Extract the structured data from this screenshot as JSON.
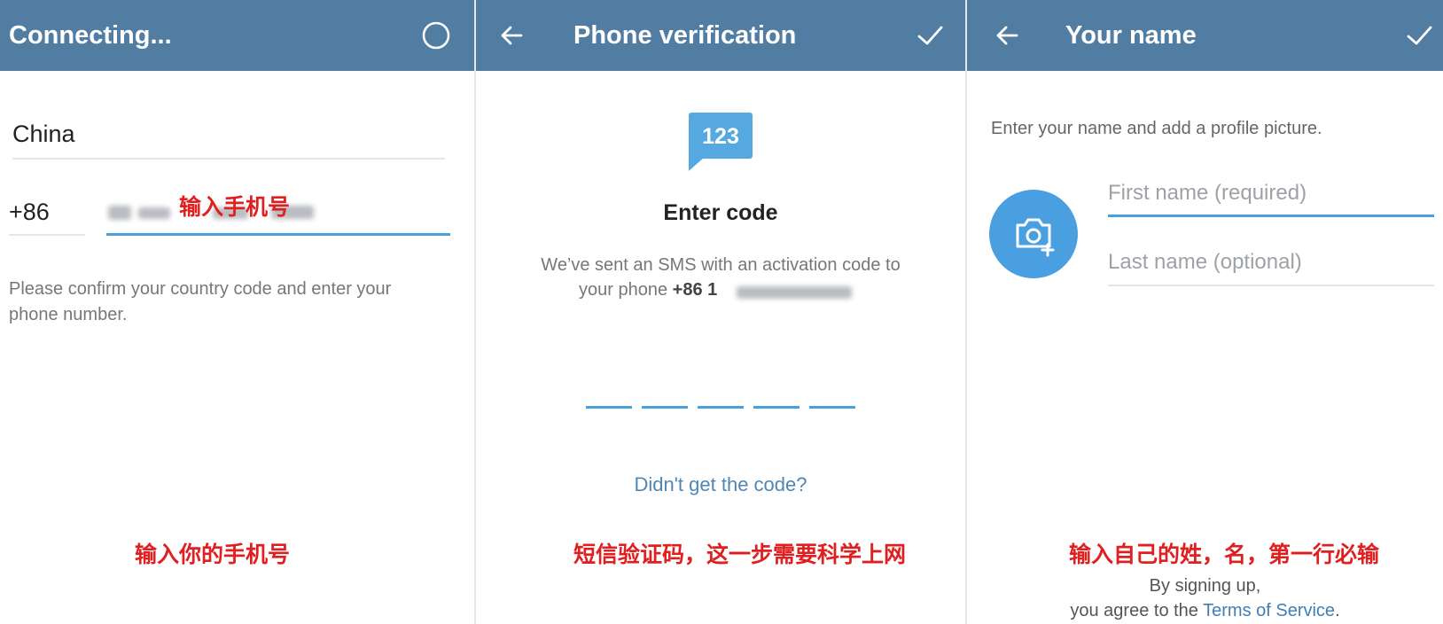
{
  "panel1": {
    "title": "Connecting...",
    "country": "China",
    "country_code": "+86",
    "phone_annotation": "输入手机号",
    "hint": "Please confirm your country code and enter your phone number.",
    "bottom_annotation": "输入你的手机号"
  },
  "panel2": {
    "title": "Phone verification",
    "code_badge": "123",
    "heading": "Enter code",
    "sms_text": "We’ve sent an SMS with an activation code to",
    "sms_prefix": "your phone ",
    "phone_visible": "+86 1",
    "code_slots": 5,
    "resend_link": "Didn't get the code?",
    "bottom_annotation": "短信验证码，这一步需要科学上网"
  },
  "panel3": {
    "title": "Your name",
    "intro": "Enter your name and add a profile picture.",
    "first_name_placeholder": "First name (required)",
    "last_name_placeholder": "Last name (optional)",
    "bottom_annotation": "输入自己的姓，名，第一行必输",
    "signup_line1": "By signing up,",
    "signup_line2_prefix": "you agree to the ",
    "terms_link": "Terms of Service",
    "signup_line2_suffix": "."
  },
  "colors": {
    "header": "#527da3",
    "accent": "#4aa0dc",
    "link": "#3f7fb5",
    "annotation": "#e02020"
  },
  "icons": [
    "loading-circle-icon",
    "back-arrow-icon",
    "checkmark-icon",
    "sms-code-icon",
    "camera-add-icon"
  ]
}
